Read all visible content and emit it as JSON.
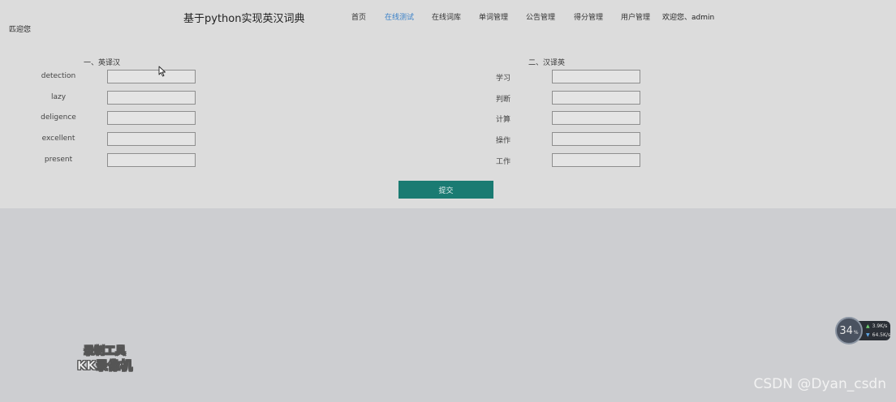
{
  "header": {
    "corner_text": "匹迎您",
    "site_title": "基于python实现英汉词典",
    "nav": [
      {
        "label": "首页",
        "active": false
      },
      {
        "label": "在线测试",
        "active": true
      },
      {
        "label": "在线词库",
        "active": false
      },
      {
        "label": "单词管理",
        "active": false
      },
      {
        "label": "公告管理",
        "active": false
      },
      {
        "label": "得分管理",
        "active": false
      },
      {
        "label": "用户管理",
        "active": false
      }
    ],
    "welcome": "欢迎您、admin"
  },
  "quiz": {
    "en_to_cn": {
      "title": "一、英译汉",
      "words": [
        "detection",
        "lazy",
        "deligence",
        "excellent",
        "present"
      ]
    },
    "cn_to_en": {
      "title": "二、汉译英",
      "words": [
        "学习",
        "判断",
        "计算",
        "操作",
        "工作"
      ]
    },
    "submit_label": "提交"
  },
  "overlays": {
    "recorder_line1": "录制工具",
    "recorder_line2": "KK录像机",
    "csdn_watermark": "CSDN @Dyan_csdn",
    "net_widget": {
      "value": "34",
      "unit": "%",
      "up": "3.9",
      "up_unit": "K/s",
      "down": "64.5",
      "down_unit": "K/s"
    }
  },
  "colors": {
    "accent": "#1a7b72",
    "nav_active": "#3a80c8",
    "panel_bg": "#dcdcdc",
    "page_bg": "#cdced1"
  }
}
